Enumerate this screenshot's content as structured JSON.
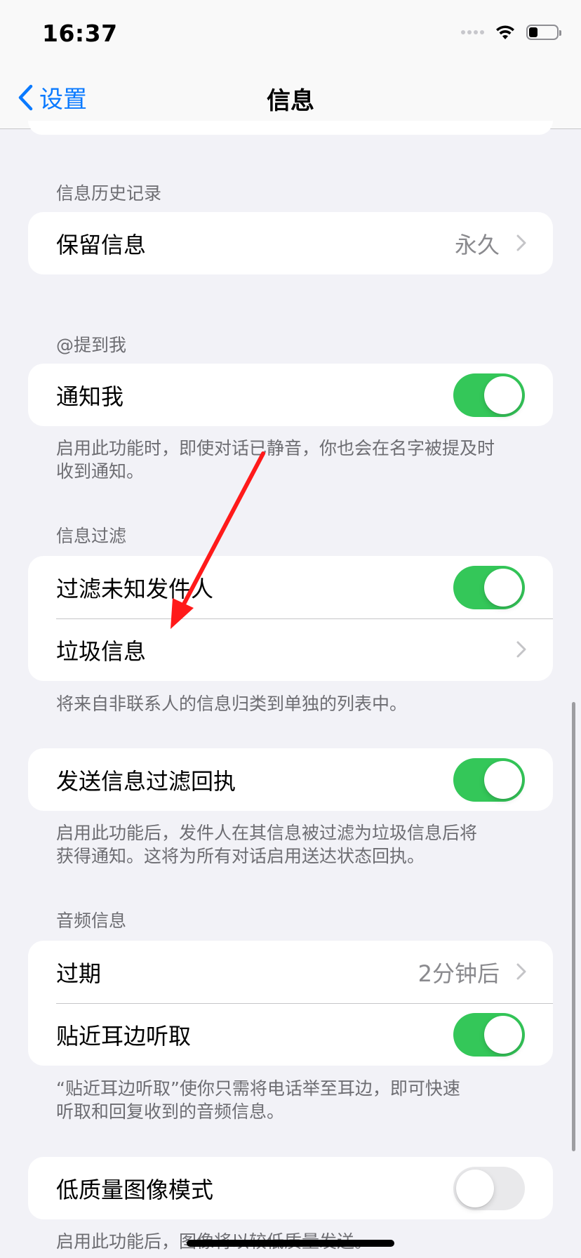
{
  "status_bar": {
    "time": "16:37"
  },
  "nav": {
    "back_label": "设置",
    "title": "信息"
  },
  "sections": {
    "history": {
      "header": "信息历史记录",
      "keep_messages": {
        "label": "保留信息",
        "value": "永久"
      }
    },
    "mentions": {
      "header": "@提到我",
      "notify_me": {
        "label": "通知我",
        "toggle": "on"
      },
      "footer_line1": "启用此功能时，即使对话已静音，你也会在名字被提及时",
      "footer_line2": "收到通知。"
    },
    "filtering": {
      "header": "信息过滤",
      "filter_unknown": {
        "label": "过滤未知发件人",
        "toggle": "on"
      },
      "junk": {
        "label": "垃圾信息"
      },
      "footer": "将来自非联系人的信息归类到单独的列表中。"
    },
    "filter_receipt": {
      "send_receipt": {
        "label": "发送信息过滤回执",
        "toggle": "on"
      },
      "footer_line1": "启用此功能后，发件人在其信息被过滤为垃圾信息后将",
      "footer_line2": "获得通知。这将为所有对话启用送达状态回执。"
    },
    "audio": {
      "header": "音频信息",
      "expire": {
        "label": "过期",
        "value": "2分钟后"
      },
      "raise_to_listen": {
        "label": "贴近耳边听取",
        "toggle": "on"
      },
      "footer_line1": "“贴近耳边听取”使你只需将电话举至耳边，即可快速",
      "footer_line2": "听取和回复收到的音频信息。"
    },
    "low_quality": {
      "mode": {
        "label": "低质量图像模式",
        "toggle": "off"
      },
      "footer": "启用此功能后，图像将以较低质量发送。"
    }
  },
  "colors": {
    "accent": "#0a7aff",
    "toggle_on": "#34c759",
    "toggle_off": "#e9e9eb",
    "annotation_arrow": "#ff1a1a"
  }
}
